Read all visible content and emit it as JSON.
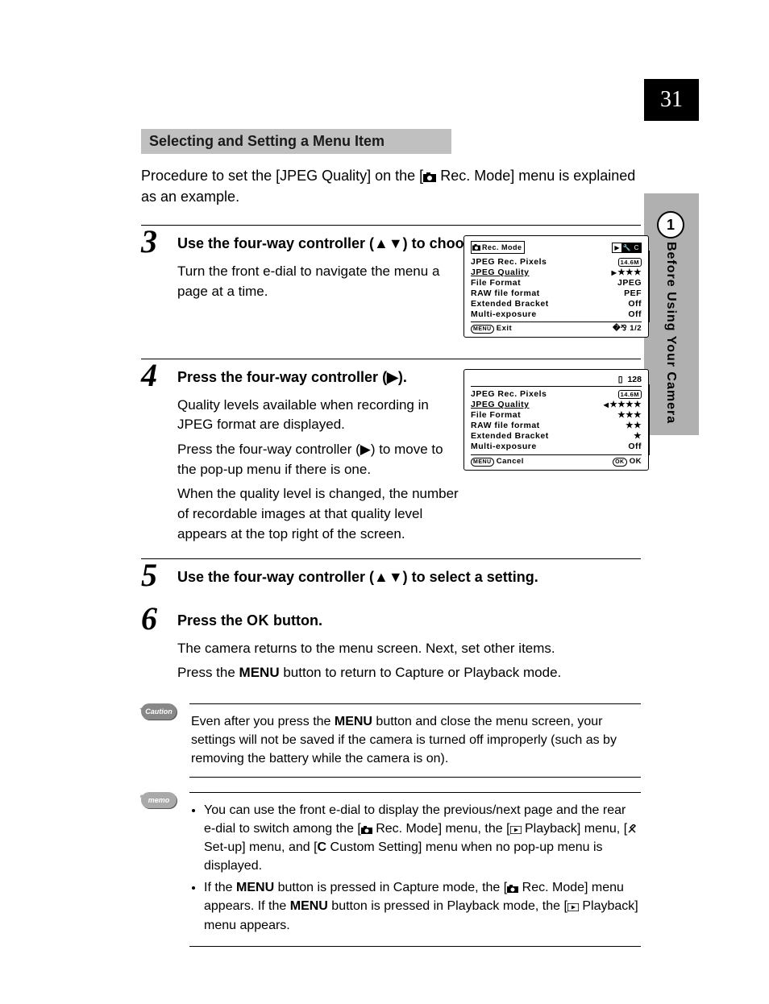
{
  "page_number": "31",
  "section_number": "1",
  "section_title": "Before Using Your Camera",
  "heading": "Selecting and Setting a Menu Item",
  "intro": "Procedure to set the [JPEG Quality] on the [📷 Rec. Mode] menu is explained as an example.",
  "steps": {
    "3": {
      "num": "3",
      "title": "Use the four-way controller (▲▼) to choose an item.",
      "desc": "Turn the front e-dial to navigate the menu a page at a time."
    },
    "4": {
      "num": "4",
      "title": "Press the four-way controller (▶).",
      "desc1": "Quality levels available when recording in JPEG format are displayed.",
      "desc2": "Press the four-way controller (▶) to move to the pop-up menu if there is one.",
      "desc3": "When the quality level is changed, the number of recordable images at that quality level appears at the top right of the screen."
    },
    "5": {
      "num": "5",
      "title": "Use the four-way controller (▲▼) to select a setting."
    },
    "6": {
      "num": "6",
      "title_pre": "Press the ",
      "title_ok": "OK",
      "title_post": " button.",
      "desc1": "The camera returns to the menu screen. Next, set other items.",
      "desc2_pre": "Press the ",
      "desc2_menu": "MENU",
      "desc2_post": " button to return to Capture or Playback mode."
    }
  },
  "lcd1": {
    "title": "Rec. Mode",
    "rows": [
      {
        "lbl": "JPEG Rec. Pixels",
        "val": "14.6M",
        "pill": true
      },
      {
        "lbl": "JPEG Quality",
        "val": "★★★",
        "sel": true,
        "arrow": true
      },
      {
        "lbl": "File Format",
        "val": "JPEG"
      },
      {
        "lbl": "RAW file format",
        "val": "PEF"
      },
      {
        "lbl": "Extended Bracket",
        "val": "Off"
      },
      {
        "lbl": "Multi-exposure",
        "val": "Off"
      }
    ],
    "footer_left": "Exit",
    "footer_right": "1/2",
    "menu_btn": "MENU"
  },
  "lcd2": {
    "count": "128",
    "rows": [
      {
        "lbl": "JPEG Rec. Pixels",
        "val": "14.6M",
        "pill": true
      },
      {
        "lbl": "JPEG Quality",
        "val": "★★★★",
        "sel": true,
        "arrowL": true
      },
      {
        "lbl": "File Format",
        "val": "★★★"
      },
      {
        "lbl": "RAW file format",
        "val": "★★"
      },
      {
        "lbl": "Extended Bracket",
        "val": "★"
      },
      {
        "lbl": "Multi-exposure",
        "val": "Off"
      }
    ],
    "footer_left": "Cancel",
    "footer_right": "OK",
    "menu_btn": "MENU",
    "ok_btn": "OK"
  },
  "caution": {
    "label": "Caution",
    "text_pre": "Even after you press the ",
    "text_menu": "MENU",
    "text_post": " button and close the menu screen, your settings will not be saved if the camera is turned off improperly (such as by removing the battery while the camera is on)."
  },
  "memo": {
    "label": "memo",
    "b1_pre": "You can use the front e-dial to display the previous/next page and the rear e-dial to switch among the [",
    "b1_m1": " Rec. Mode] menu, the [",
    "b1_m2": " Playback] menu, [",
    "b1_m3": " Set-up] menu, and [",
    "b1_c": "C",
    "b1_post": " Custom Setting] menu when no pop-up menu is displayed.",
    "b2_pre": "If the ",
    "b2_menu": "MENU",
    "b2_mid1": " button is pressed in Capture mode, the [",
    "b2_mid2": " Rec. Mode] menu appears. If the ",
    "b2_menu2": "MENU",
    "b2_mid3": " button is pressed in Playback mode, the [",
    "b2_post": " Playback] menu appears."
  }
}
